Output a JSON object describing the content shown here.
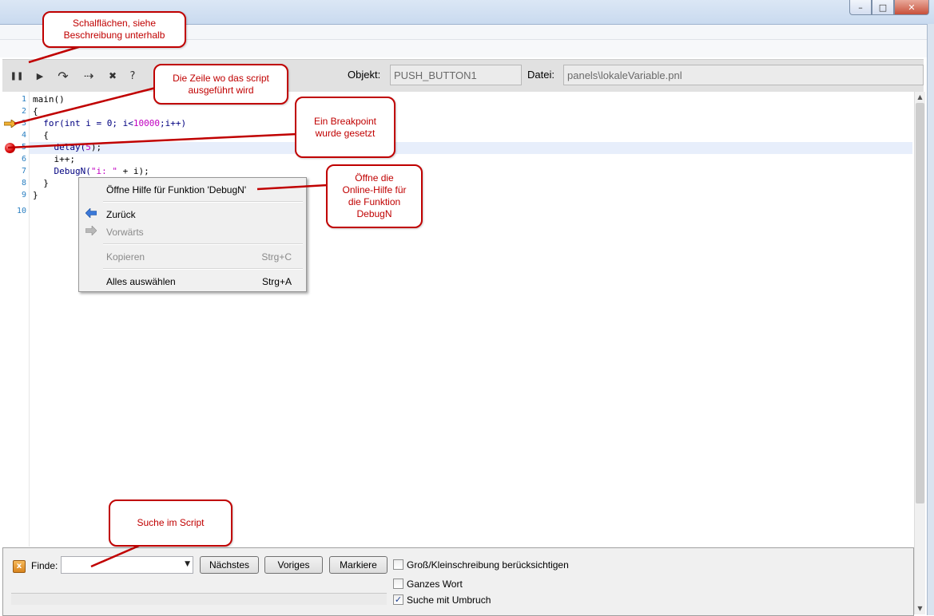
{
  "window": {
    "controls": {
      "minimize_icon": "minimize-icon",
      "maximize_icon": "maximize-icon",
      "close_icon": "close-icon"
    }
  },
  "toolbar": {
    "icons": [
      "pause-icon",
      "play-icon",
      "step-into-icon",
      "step-over-icon",
      "stop-icon",
      "help-icon"
    ],
    "pause_glyph": "❚❚",
    "play_glyph": "▶",
    "step_into_glyph": "↷",
    "step_over_glyph": "⇢",
    "stop_glyph": "✖",
    "help_glyph": "?",
    "objekt_label": "Objekt:",
    "objekt_value": "PUSH_BUTTON1",
    "datei_label": "Datei:",
    "datei_value": "panels\\lokaleVariable.pnl"
  },
  "editor": {
    "line_numbers": [
      "1",
      "2",
      "3",
      "4",
      "5",
      "6",
      "7",
      "8",
      "9",
      "10"
    ],
    "lines": {
      "l1": "main()",
      "l2": "{",
      "l3a": "  for(int i = 0; i<",
      "l3b": "10000",
      "l3c": ";i++)",
      "l4": "  {",
      "l5a": "    delay(",
      "l5b": "5",
      "l5c": ");",
      "l6": "    i++;",
      "l7a": "    DebugN(",
      "l7b": "\"i: \"",
      "l7c": " + i);",
      "l8": "  }",
      "l9": "}"
    },
    "current_line": 3,
    "breakpoint_line": 5
  },
  "context_menu": {
    "help_item": "Öffne Hilfe für Funktion 'DebugN'",
    "back_item": "Zurück",
    "forward_item": "Vorwärts",
    "copy_item": "Kopieren",
    "copy_shortcut": "Strg+C",
    "select_all_item": "Alles auswählen",
    "select_all_shortcut": "Strg+A"
  },
  "findbar": {
    "label": "Finde:",
    "input_value": "",
    "next_button": "Nächstes",
    "prev_button": "Voriges",
    "mark_button": "Markiere",
    "case_label": "Groß/Kleinschreibung berücksichtigen",
    "case_checked": false,
    "whole_word_label": "Ganzes Wort",
    "whole_word_checked": false,
    "wrap_label": "Suche mit Umbruch",
    "wrap_checked": true
  },
  "annotations": {
    "buttons_note_1": "Schalflächen, siehe",
    "buttons_note_2": "Beschreibung unterhalb",
    "line_note_1": "Die Zeile wo das script",
    "line_note_2": "ausgeführt wird",
    "breakpoint_note_1": "Ein Breakpoint",
    "breakpoint_note_2": "wurde gesetzt",
    "help_note_1": "Öffne die",
    "help_note_2": "Online-Hilfe für",
    "help_note_3": "die Funktion",
    "help_note_4": "DebugN",
    "search_note": "Suche im Script",
    "color": "#c00000"
  }
}
